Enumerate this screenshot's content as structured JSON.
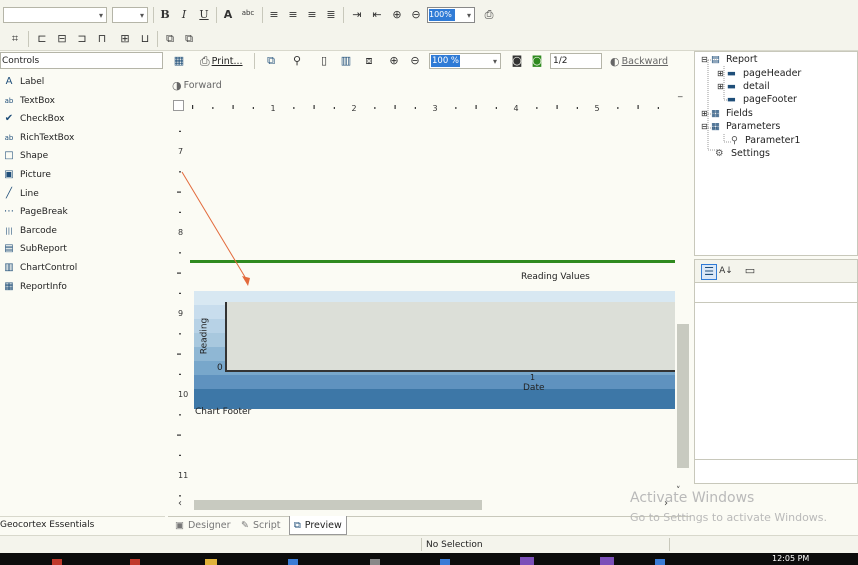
{
  "toolbar1": {
    "font_value": "",
    "size_value": "",
    "bold": "B",
    "italic": "I",
    "underline": "U",
    "spell": "abc",
    "zoom_value": "100%"
  },
  "controls": {
    "header": "Controls",
    "items": [
      {
        "label": "Label",
        "icon": "label-icon",
        "glyph": "A"
      },
      {
        "label": "TextBox",
        "icon": "textbox-icon",
        "glyph": "ab"
      },
      {
        "label": "CheckBox",
        "icon": "checkbox-icon",
        "glyph": "✔"
      },
      {
        "label": "RichTextBox",
        "icon": "richtextbox-icon",
        "glyph": "ab"
      },
      {
        "label": "Shape",
        "icon": "shape-icon",
        "glyph": "□"
      },
      {
        "label": "Picture",
        "icon": "picture-icon",
        "glyph": "▣"
      },
      {
        "label": "Line",
        "icon": "line-icon",
        "glyph": "╱"
      },
      {
        "label": "PageBreak",
        "icon": "pagebreak-icon",
        "glyph": "⋯"
      },
      {
        "label": "Barcode",
        "icon": "barcode-icon",
        "glyph": "|||"
      },
      {
        "label": "SubReport",
        "icon": "subreport-icon",
        "glyph": "▤"
      },
      {
        "label": "ChartControl",
        "icon": "chartcontrol-icon",
        "glyph": "▥"
      },
      {
        "label": "ReportInfo",
        "icon": "reportinfo-icon",
        "glyph": "▦"
      }
    ],
    "footer": "Geocortex Essentials"
  },
  "preview_toolbar": {
    "print_label": "Print...",
    "zoom_value": "100 %",
    "page_value": "1/2",
    "backward_label": "Backward",
    "forward_label": "Forward"
  },
  "ruler": {
    "h_ticks": [
      "1",
      "2",
      "3",
      "4",
      "5",
      "6"
    ],
    "v_ticks": [
      "7",
      "8",
      "9",
      "10",
      "11"
    ]
  },
  "chart": {
    "title": "Reading Values",
    "ylabel": "Reading",
    "xlabel": "Date",
    "y_zero": "0",
    "x_tick": "1",
    "footer": "Chart Footer"
  },
  "chart_data": {
    "type": "bar",
    "title": "Reading Values",
    "xlabel": "Date",
    "ylabel": "Reading",
    "categories": [
      "1"
    ],
    "values": [
      0
    ],
    "grid": false
  },
  "tree": {
    "report": "Report",
    "page_header": "pageHeader",
    "detail": "detail",
    "page_footer": "pageFooter",
    "fields": "Fields",
    "parameters": "Parameters",
    "parameter1": "Parameter1",
    "settings": "Settings"
  },
  "tabs": {
    "designer": "Designer",
    "script": "Script",
    "preview": "Preview"
  },
  "status": {
    "selection": "No Selection"
  },
  "watermark": {
    "line1": "Activate Windows",
    "line2": "Go to Settings to activate Windows."
  },
  "taskbar": {
    "time": "12:05 PM"
  },
  "colors": {
    "chart_band_dark": "#3d77a7",
    "chart_band_light": "#a8c8de",
    "chart_plot": "#dcdfd8",
    "green_line": "#2f8a1f",
    "arrow": "#e36a3c",
    "selection": "#2f7bd6"
  }
}
